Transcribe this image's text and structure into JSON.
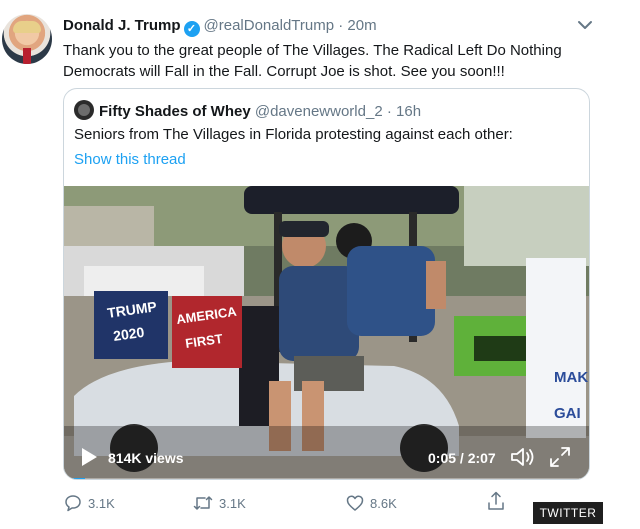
{
  "tweet": {
    "author_name": "Donald J. Trump",
    "handle": "@realDonaldTrump",
    "separator": "·",
    "time": "20m",
    "text": "Thank you to the great people of The Villages. The Radical Left Do Nothing Democrats will Fall in the Fall. Corrupt Joe is shot. See you soon!!!",
    "verified_icon": "✓"
  },
  "quoted": {
    "author_name": "Fifty Shades of Whey",
    "handle": "@davenewworld_2",
    "separator": "·",
    "time": "16h",
    "text": "Seniors from The Villages in Florida protesting against each other:",
    "show_thread_label": "Show this thread"
  },
  "video": {
    "views": "814K views",
    "time_display": "0:05 / 2:07",
    "progress": 0.04,
    "signs": {
      "trump_line1": "TRUMP",
      "trump_line2": "2020",
      "america_line1": "AMERICA",
      "america_line2": "FIRST",
      "right_sign_line1": "MAK",
      "right_sign_line2": "GAI"
    }
  },
  "actions": {
    "reply_count": "3.1K",
    "retweet_count": "3.1K",
    "like_count": "8.6K"
  },
  "source_badge": "TWITTER",
  "colors": {
    "accent": "#1da1f2",
    "text": "#14171a",
    "muted": "#657786"
  }
}
